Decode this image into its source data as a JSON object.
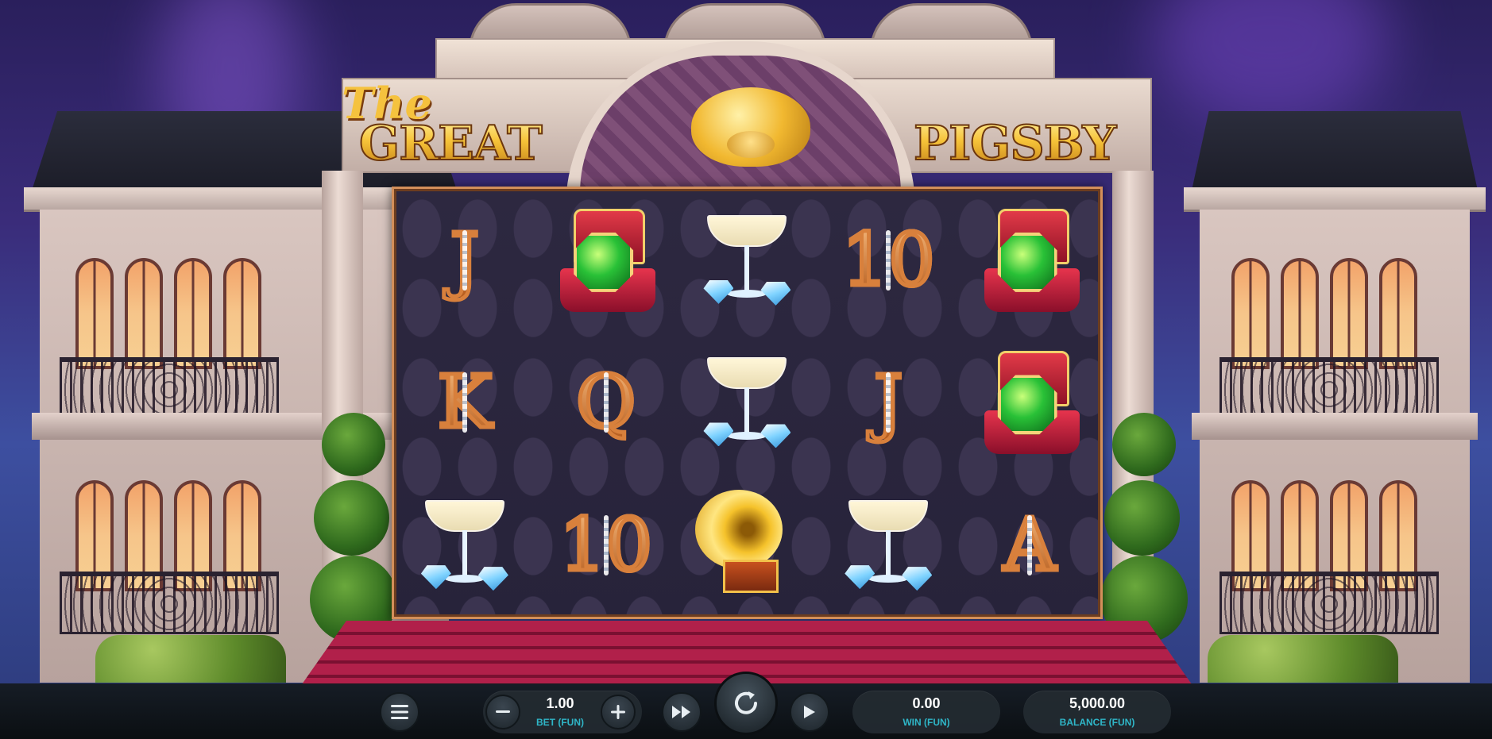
{
  "title": {
    "the": "The",
    "great": "GREAT",
    "pigsby": "PIGSBY"
  },
  "reels": {
    "grid": [
      [
        "J",
        "ring-box",
        "champagne",
        "10",
        "ring-box"
      ],
      [
        "K",
        "Q",
        "champagne",
        "J",
        "ring-box"
      ],
      [
        "champagne",
        "10",
        "gramophone",
        "champagne",
        "A"
      ]
    ]
  },
  "controls": {
    "menu_icon": "hamburger-icon",
    "bet_value": "1.00",
    "bet_label": "BET (FUN)",
    "win_value": "0.00",
    "win_label": "WIN (FUN)",
    "balance_value": "5,000.00",
    "balance_label": "BALANCE (FUN)"
  },
  "colors": {
    "accent_label": "#2fb6c8",
    "reel_frame": "#d38f5a",
    "title_gold": "#f6c339"
  }
}
